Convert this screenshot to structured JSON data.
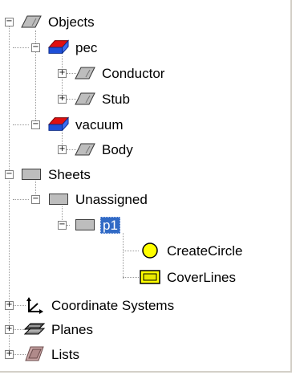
{
  "tree": {
    "objects": "Objects",
    "pec": "pec",
    "conductor": "Conductor",
    "stub": "Stub",
    "vacuum": "vacuum",
    "body": "Body",
    "sheets": "Sheets",
    "unassigned": "Unassigned",
    "p1": "p1",
    "create_circle": "CreateCircle",
    "cover_lines": "CoverLines",
    "coordinate_systems": "Coordinate Systems",
    "planes": "Planes",
    "lists": "Lists"
  },
  "expanders": {
    "expanded": "−",
    "collapsed": "+"
  },
  "colors": {
    "selection": "#316ac5",
    "material_red": "#e01010",
    "material_blue": "#1e4fd8",
    "circle_yellow": "#ffff00"
  }
}
